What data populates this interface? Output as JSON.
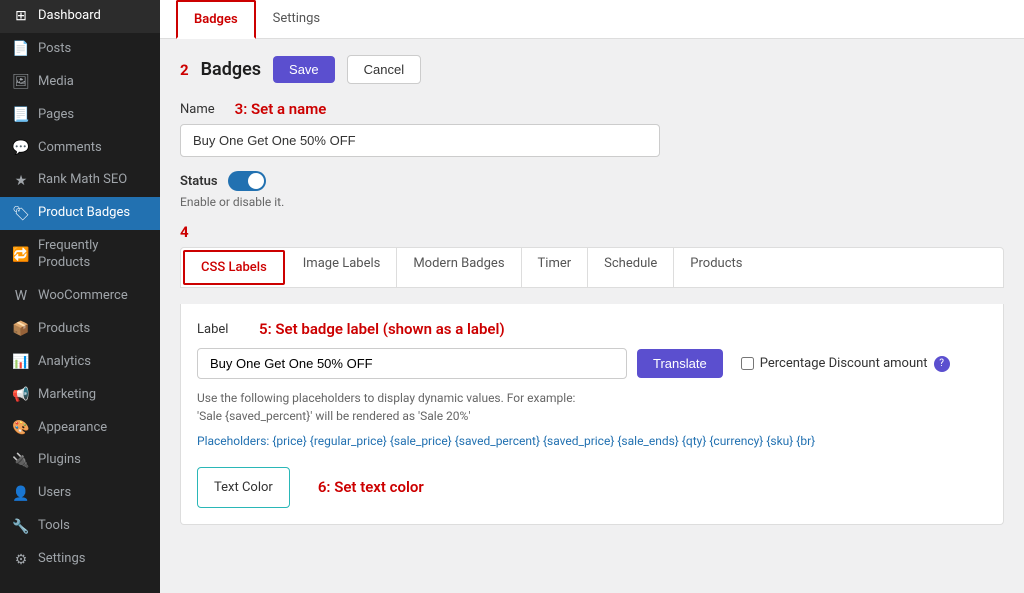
{
  "sidebar": {
    "items": [
      {
        "id": "dashboard",
        "label": "Dashboard",
        "icon": "⊞"
      },
      {
        "id": "posts",
        "label": "Posts",
        "icon": "📄"
      },
      {
        "id": "media",
        "label": "Media",
        "icon": "🖼"
      },
      {
        "id": "pages",
        "label": "Pages",
        "icon": "📃"
      },
      {
        "id": "comments",
        "label": "Comments",
        "icon": "💬"
      },
      {
        "id": "rank-math-seo",
        "label": "Rank Math SEO",
        "icon": "★"
      },
      {
        "id": "product-badges",
        "label": "Product Badges",
        "icon": "🏷"
      },
      {
        "id": "frequently-products",
        "label": "Frequently Products",
        "icon": "🔁"
      },
      {
        "id": "woocommerce",
        "label": "WooCommerce",
        "icon": "W"
      },
      {
        "id": "products",
        "label": "Products",
        "icon": "📦"
      },
      {
        "id": "analytics",
        "label": "Analytics",
        "icon": "📊"
      },
      {
        "id": "marketing",
        "label": "Marketing",
        "icon": "📢"
      },
      {
        "id": "appearance",
        "label": "Appearance",
        "icon": "🎨"
      },
      {
        "id": "plugins",
        "label": "Plugins",
        "icon": "🔌"
      },
      {
        "id": "users",
        "label": "Users",
        "icon": "👤"
      },
      {
        "id": "tools",
        "label": "Tools",
        "icon": "🔧"
      },
      {
        "id": "settings",
        "label": "Settings",
        "icon": "⚙"
      }
    ]
  },
  "top_tabs": [
    {
      "id": "badges",
      "label": "Badges",
      "active": true
    },
    {
      "id": "settings",
      "label": "Settings",
      "active": false
    }
  ],
  "step2": "2",
  "section_title": "Badges",
  "btn_save": "Save",
  "btn_cancel": "Cancel",
  "step3_annotation": "3: Set a name",
  "name_label": "Name",
  "name_value": "Buy One Get One 50% OFF",
  "status_label": "Status",
  "status_hint": "Enable or disable it.",
  "step4": "4",
  "sub_tabs": [
    {
      "id": "css-labels",
      "label": "CSS Labels",
      "active": true
    },
    {
      "id": "image-labels",
      "label": "Image Labels",
      "active": false
    },
    {
      "id": "modern-badges",
      "label": "Modern Badges",
      "active": false
    },
    {
      "id": "timer",
      "label": "Timer",
      "active": false
    },
    {
      "id": "schedule",
      "label": "Schedule",
      "active": false
    },
    {
      "id": "products",
      "label": "Products",
      "active": false
    }
  ],
  "label_field_label": "Label",
  "step5_annotation": "5: Set badge label (shown as a label)",
  "label_value": "Buy One Get One 50% OFF",
  "btn_translate": "Translate",
  "percentage_label": "Percentage Discount amount",
  "placeholder_info_line1": "Use the following placeholders to display dynamic values. For example:",
  "placeholder_info_line2": "'Sale {saved_percent}' will be rendered as 'Sale 20%'",
  "placeholders_label": "Placeholders:",
  "placeholders": "{price} {regular_price} {sale_price} {saved_percent} {saved_price} {sale_ends} {qty} {currency} {sku} {br}",
  "step6_annotation": "6: Set text color",
  "text_color_label": "Text Color"
}
